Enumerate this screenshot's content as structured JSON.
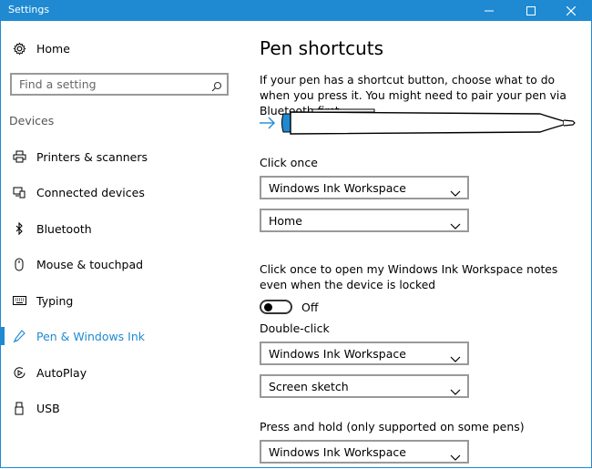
{
  "window": {
    "title": "Settings"
  },
  "sidebar": {
    "home_label": "Home",
    "search_placeholder": "Find a setting",
    "section_label": "Devices",
    "items": [
      {
        "label": "Printers & scanners",
        "icon": "printer-icon"
      },
      {
        "label": "Connected devices",
        "icon": "connected-devices-icon"
      },
      {
        "label": "Bluetooth",
        "icon": "bluetooth-icon"
      },
      {
        "label": "Mouse & touchpad",
        "icon": "mouse-icon"
      },
      {
        "label": "Typing",
        "icon": "keyboard-icon"
      },
      {
        "label": "Pen & Windows Ink",
        "icon": "pen-icon",
        "active": true
      },
      {
        "label": "AutoPlay",
        "icon": "autoplay-icon"
      },
      {
        "label": "USB",
        "icon": "usb-icon"
      }
    ]
  },
  "main": {
    "title": "Pen shortcuts",
    "description": "If your pen has a shortcut button, choose what to do when you press it. You might need to pair your pen via Bluetooth first.",
    "click_once": {
      "label": "Click once",
      "app_value": "Windows Ink Workspace",
      "action_value": "Home",
      "locked_note": "Click once to open my Windows Ink Workspace notes even when the device is locked",
      "toggle_state": "Off"
    },
    "double_click": {
      "label": "Double-click",
      "app_value": "Windows Ink Workspace",
      "action_value": "Screen sketch"
    },
    "press_hold": {
      "label": "Press and hold (only supported on some pens)",
      "app_value": "Windows Ink Workspace"
    }
  },
  "colors": {
    "accent": "#1f8ad2",
    "titlebar": "#1f8ad2"
  }
}
